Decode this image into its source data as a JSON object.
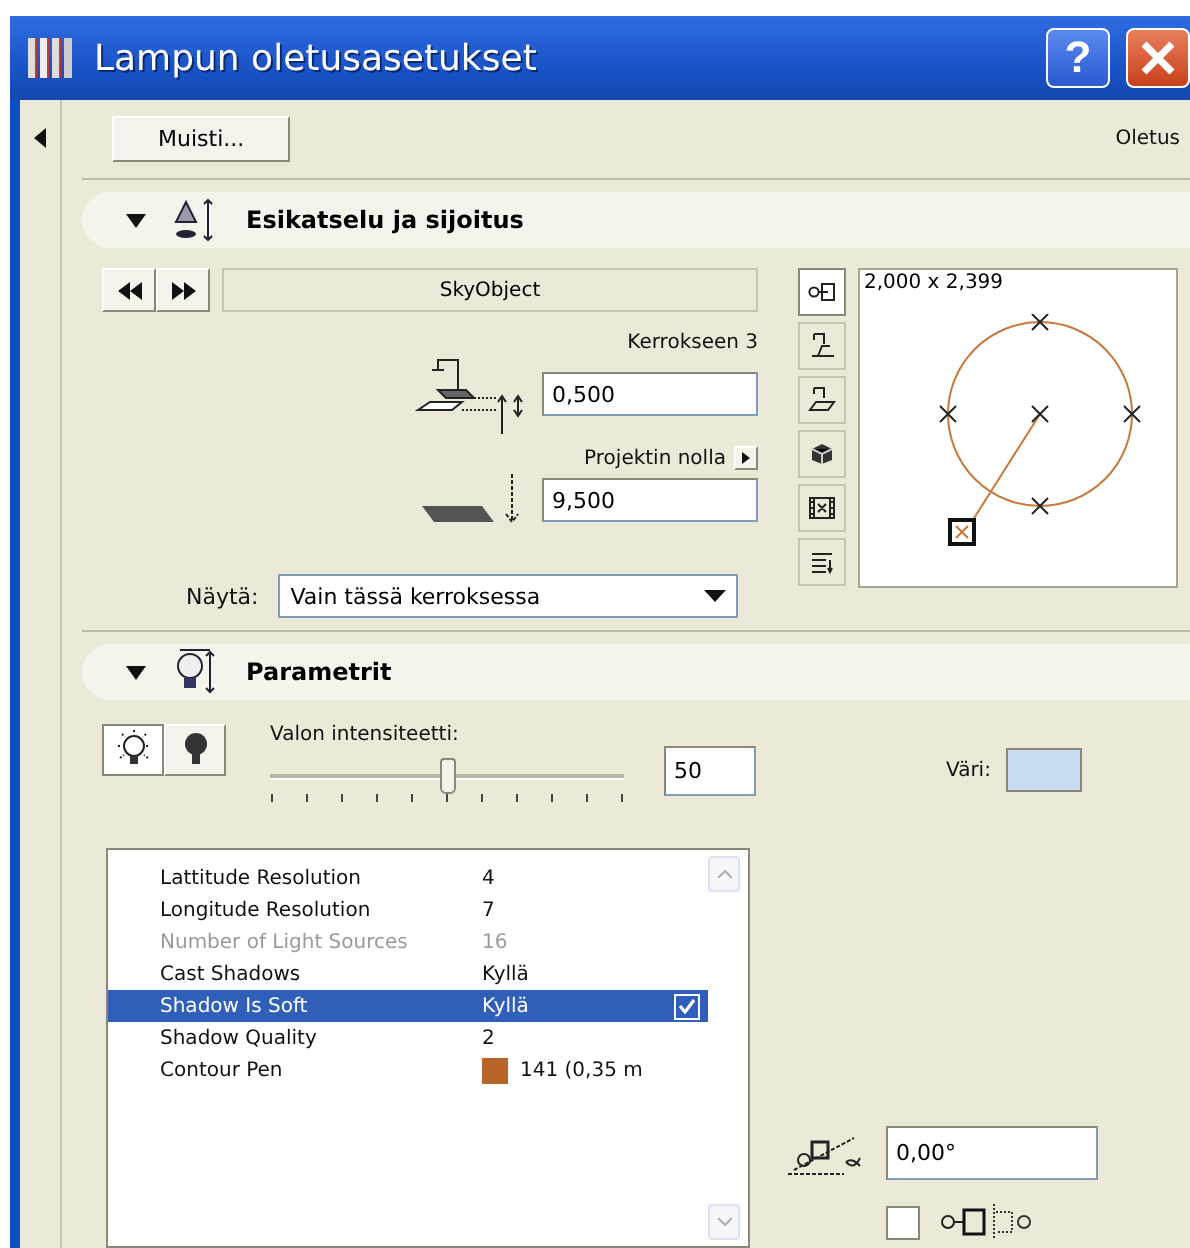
{
  "window": {
    "title": "Lampun oletusasetukset",
    "help_button": "?"
  },
  "toolbar": {
    "memory_button": "Muisti...",
    "preset_label": "Oletus"
  },
  "preview_section": {
    "title": "Esikatselu ja sijoitus",
    "expanded": true,
    "object_name": "SkyObject",
    "elevation_label": "Kerrokseen 3",
    "elevation_value": "0,500",
    "reference_label": "Projektin nolla",
    "reference_value": "9,500",
    "show_label": "Näytä:",
    "show_value": "Vain tässä kerroksessa",
    "view_tabs": [
      {
        "selected": true
      },
      {
        "selected": false
      },
      {
        "selected": false
      },
      {
        "selected": false
      },
      {
        "selected": false
      },
      {
        "selected": false
      }
    ],
    "dimensions": "2,000 x 2,399"
  },
  "parameters_section": {
    "title": "Parametrit",
    "expanded": true,
    "light_modes": [
      {
        "selected": true
      },
      {
        "selected": false
      }
    ],
    "intensity_label": "Valon intensiteetti:",
    "intensity": {
      "level": 0.5
    },
    "intensity_value": "50",
    "color_label": "Väri:",
    "color": "#c8dcf2",
    "rows": [
      {
        "name": "Lattitude Resolution",
        "value": "4",
        "disabled": false,
        "selected": false
      },
      {
        "name": "Longitude Resolution",
        "value": "7",
        "disabled": false,
        "selected": false
      },
      {
        "name": "Number of Light Sources",
        "value": "16",
        "disabled": true,
        "selected": false
      },
      {
        "name": "Cast Shadows",
        "value": "Kyllä",
        "disabled": false,
        "selected": false
      },
      {
        "name": "Shadow Is Soft",
        "value": "Kyllä",
        "disabled": false,
        "selected": true,
        "toggle": {
          "checked": true
        }
      },
      {
        "name": "Shadow Quality",
        "value": "2",
        "disabled": false,
        "selected": false
      },
      {
        "name": "Contour Pen",
        "value": "141 (0,35 m",
        "disabled": false,
        "selected": false,
        "color": "#b8652a"
      }
    ],
    "angle_value": "0,00°",
    "anchor_checkbox": {
      "checked": false
    }
  }
}
